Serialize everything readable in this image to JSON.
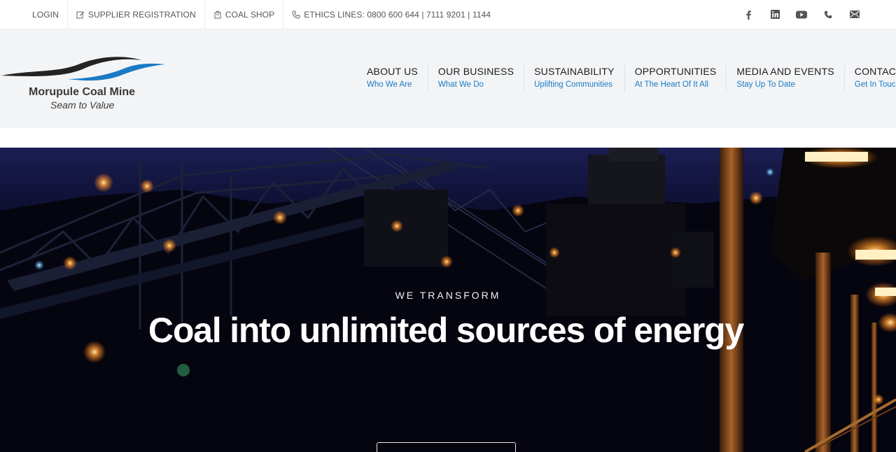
{
  "topbar": {
    "login": "LOGIN",
    "supplier_registration": "SUPPLIER REGISTRATION",
    "coal_shop": "COAL SHOP",
    "ethics_lines": "ETHICS LINES: 0800 600 644 | 7111 9201 | 1144",
    "icons": [
      "edit-icon",
      "bag-icon",
      "phone-icon"
    ],
    "social": [
      "facebook-icon",
      "linkedin-icon",
      "youtube-icon",
      "phone-icon",
      "email-icon"
    ]
  },
  "brand": {
    "name": "Morupule Coal Mine",
    "tagline": "Seam to Value",
    "colors": {
      "dark_wave": "#232323",
      "blue_wave": "#1a7bc4"
    }
  },
  "nav": {
    "items": [
      {
        "label": "ABOUT US",
        "sub": "Who We Are"
      },
      {
        "label": "OUR BUSINESS",
        "sub": "What We Do"
      },
      {
        "label": "SUSTAINABILITY",
        "sub": "Uplifting Communities"
      },
      {
        "label": "OPPORTUNITIES",
        "sub": "At The Heart Of It All"
      },
      {
        "label": "MEDIA AND EVENTS",
        "sub": "Stay Up To Date"
      },
      {
        "label": "CONTACT US",
        "sub": "Get In Touch"
      }
    ],
    "accent_color": "#1a7bc4"
  },
  "hero": {
    "kicker": "WE TRANSFORM",
    "title": "Coal into unlimited sources of energy",
    "button_label": ""
  }
}
